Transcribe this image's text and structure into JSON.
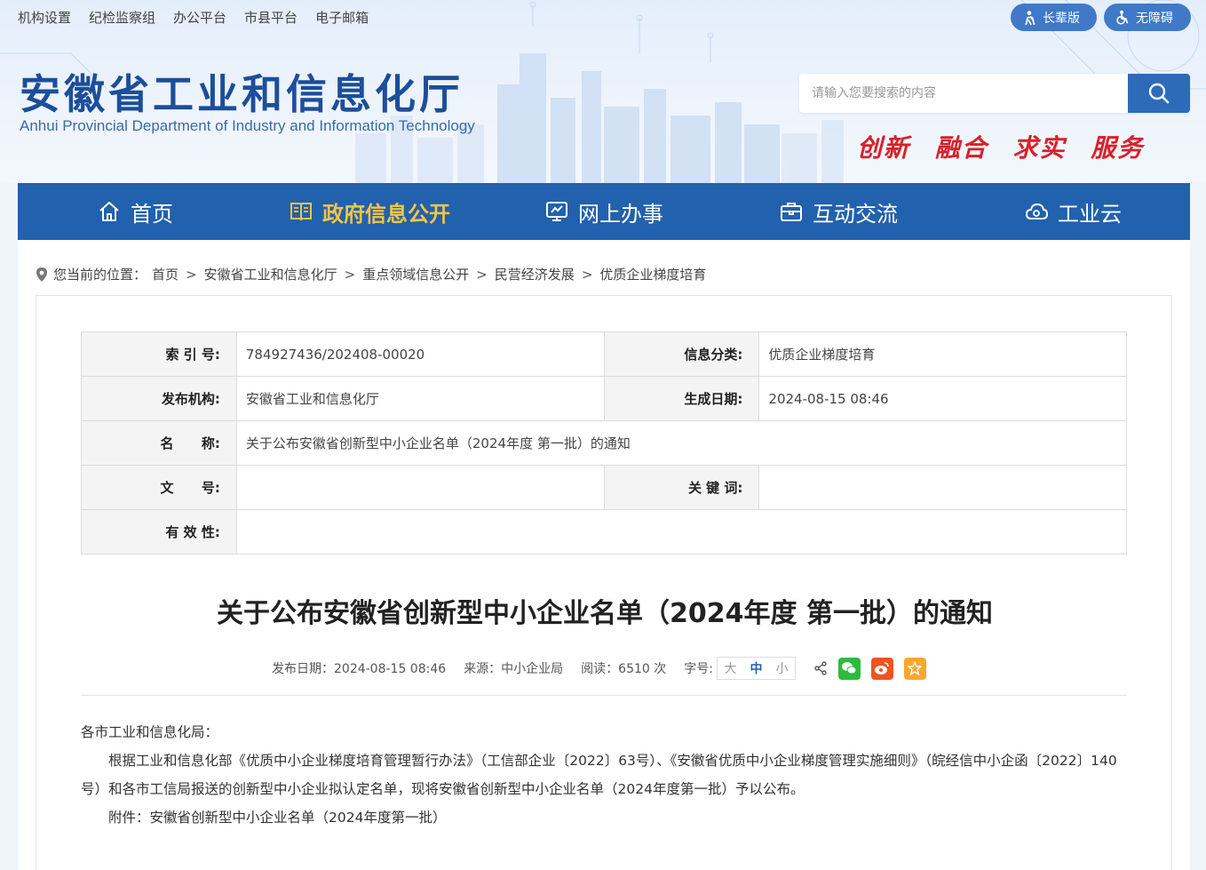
{
  "top_links": [
    "机构设置",
    "纪检监察组",
    "办公平台",
    "市县平台",
    "电子邮箱"
  ],
  "elder_mode": "长辈版",
  "accessibility": "无障碍",
  "site": {
    "title": "安徽省工业和信息化厅",
    "subtitle": "Anhui Provincial Department of Industry and Information Technology"
  },
  "search": {
    "placeholder": "请输入您要搜索的内容",
    "icon": "search-icon"
  },
  "slogan": [
    "创新",
    "融合",
    "求实",
    "服务"
  ],
  "nav": [
    {
      "label": "首页",
      "icon": "home-icon"
    },
    {
      "label": "政府信息公开",
      "icon": "book-icon",
      "active": true
    },
    {
      "label": "网上办事",
      "icon": "monitor-icon"
    },
    {
      "label": "互动交流",
      "icon": "briefcase-icon"
    },
    {
      "label": "工业云",
      "icon": "cloud-icon"
    }
  ],
  "breadcrumb": {
    "prefix": "您当前的位置：",
    "items": [
      "首页",
      "安徽省工业和信息化厅",
      "重点领域信息公开",
      "民营经济发展",
      "优质企业梯度培育"
    ]
  },
  "meta": {
    "index_label": "索 引 号:",
    "index_value": "784927436/202408-00020",
    "category_label": "信息分类:",
    "category_value": "优质企业梯度培育",
    "publisher_label": "发布机构:",
    "publisher_value": "安徽省工业和信息化厅",
    "date_label": "生成日期:",
    "date_value": "2024-08-15 08:46",
    "name_label": "名      称:",
    "name_value": "关于公布安徽省创新型中小企业名单（2024年度 第一批）的通知",
    "docno_label": "文      号:",
    "docno_value": "",
    "keywords_label": "关 键 词:",
    "keywords_value": "",
    "validity_label": "有 效 性:",
    "validity_value": ""
  },
  "article": {
    "title": "关于公布安徽省创新型中小企业名单（2024年度 第一批）的通知",
    "publish_date": "发布日期：2024-08-15 08:46",
    "source": "来源：中小企业局",
    "views": "阅读：6510 次",
    "font_size_label": "字号:",
    "font_sizes": [
      "大",
      "中",
      "小"
    ],
    "greeting": "各市工业和信息化局：",
    "paragraph": "根据工业和信息化部《优质中小企业梯度培育管理暂行办法》（工信部企业〔2022〕63号）、《安徽省优质中小企业梯度管理实施细则》（皖经信中小企函〔2022〕140号）和各市工信局报送的创新型中小企业拟认定名单，现将安徽省创新型中小企业名单（2024年度第一批）予以公布。",
    "attachment_prefix": "附件：",
    "attachment": "安徽省创新型中小企业名单（2024年度第一批）"
  },
  "colors": {
    "nav_bg": "#2261ad",
    "nav_active": "#f5c544",
    "title_blue": "#1c4e9a",
    "slogan_red": "#d9202a"
  }
}
